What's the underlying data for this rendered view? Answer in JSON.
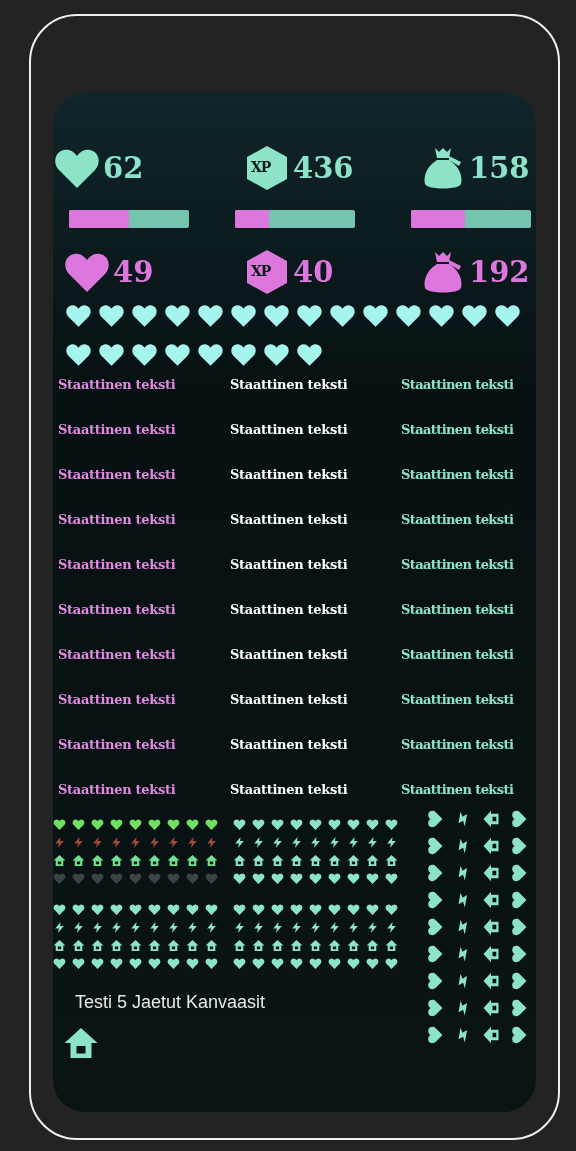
{
  "stats": [
    {
      "kind": "heart",
      "value": "62",
      "level": 0.5
    },
    {
      "kind": "xp",
      "label": "XP",
      "value": "436",
      "level": 0.28
    },
    {
      "kind": "bag",
      "value": "158",
      "level": 0.45
    }
  ],
  "enemy_stats": [
    {
      "kind": "heart",
      "value": "49"
    },
    {
      "kind": "xp",
      "label": "XP",
      "value": "40"
    },
    {
      "kind": "bag",
      "value": "192"
    }
  ],
  "life_hearts": [
    {
      "filled": true
    },
    {
      "filled": true
    },
    {
      "filled": true
    },
    {
      "filled": true
    },
    {
      "filled": true
    },
    {
      "filled": true
    },
    {
      "filled": true
    },
    {
      "filled": true
    },
    {
      "filled": true
    },
    {
      "filled": true
    },
    {
      "filled": true
    },
    {
      "filled": true
    },
    {
      "filled": true
    },
    {
      "filled": true
    },
    {
      "filled": true
    },
    {
      "filled": true
    },
    {
      "filled": true
    },
    {
      "filled": true
    },
    {
      "filled": true
    },
    {
      "filled": true
    },
    {
      "filled": true
    },
    {
      "filled": true
    }
  ],
  "text_columns": [
    {
      "color": "#e08ae0",
      "rows": [
        "Staattinen teksti",
        "Staattinen teksti",
        "Staattinen teksti",
        "Staattinen teksti",
        "Staattinen teksti",
        "Staattinen teksti",
        "Staattinen teksti",
        "Staattinen teksti",
        "Staattinen teksti",
        "Staattinen teksti"
      ]
    },
    {
      "color": "#ffffff",
      "rows": [
        "Staattinen teksti",
        "Staattinen teksti",
        "Staattinen teksti",
        "Staattinen teksti",
        "Staattinen teksti",
        "Staattinen teksti",
        "Staattinen teksti",
        "Staattinen teksti",
        "Staattinen teksti",
        "Staattinen teksti"
      ]
    },
    {
      "color": "#8de3c8",
      "rows": [
        "Staattinen teksti",
        "Staattinen teksti",
        "Staattinen teksti",
        "Staattinen teksti",
        "Staattinen teksti",
        "Staattinen teksti",
        "Staattinen teksti",
        "Staattinen teksti",
        "Staattinen teksti",
        "Staattinen teksti"
      ]
    }
  ],
  "icon_grids": [
    {
      "rows": [
        {
          "kind": "heart",
          "color": "#6fe060"
        },
        {
          "kind": "bolt",
          "color": "#a0483a"
        },
        {
          "kind": "house",
          "color": "#6fe090"
        },
        {
          "kind": "heart",
          "color": "#3a4444"
        }
      ]
    },
    {
      "rows": [
        {
          "kind": "heart",
          "color": "#8de3c8"
        },
        {
          "kind": "bolt",
          "color": "#8de3c8"
        },
        {
          "kind": "house",
          "color": "#8de3c8"
        },
        {
          "kind": "heart",
          "color": "#8de3c8"
        }
      ]
    },
    {
      "rows": [
        {
          "kind": "heart",
          "color": "#8de3c8"
        },
        {
          "kind": "bolt",
          "color": "#8de3c8"
        },
        {
          "kind": "house",
          "color": "#8de3c8"
        },
        {
          "kind": "heart",
          "color": "#8de3c8"
        }
      ]
    },
    {
      "rows": [
        {
          "kind": "heart",
          "color": "#8de3c8"
        },
        {
          "kind": "bolt",
          "color": "#8de3c8"
        },
        {
          "kind": "house",
          "color": "#8de3c8"
        },
        {
          "kind": "heart",
          "color": "#8de3c8"
        }
      ]
    }
  ],
  "side_icons": [
    {
      "kind": "heart"
    },
    {
      "kind": "bolt"
    },
    {
      "kind": "house"
    },
    {
      "kind": "heart"
    }
  ],
  "title": "Testi 5 Jaetut Kanvaasit"
}
